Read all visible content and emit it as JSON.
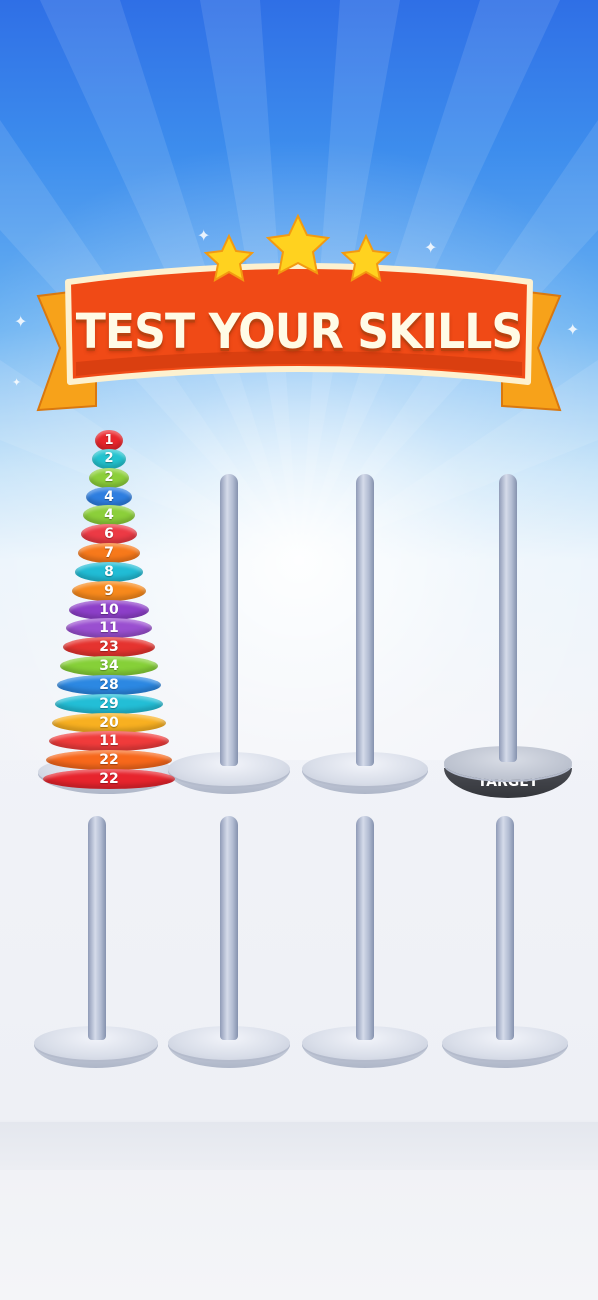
{
  "banner": {
    "title": "TEST YOUR SKILLS",
    "star_count": 3
  },
  "target_label": "TARGET",
  "colors": {
    "banner_fill": "#f04a16",
    "banner_fold": "#f7a21a",
    "star": "#ffd21f",
    "pole": "#b3bdd3",
    "base": "#d9dee9",
    "target_base_band": "#3d3f45"
  },
  "rings": [
    {
      "label": "1",
      "color": "#e8262c"
    },
    {
      "label": "2",
      "color": "#23c3cf"
    },
    {
      "label": "2",
      "color": "#8ccf3a"
    },
    {
      "label": "4",
      "color": "#2e7ee0"
    },
    {
      "label": "4",
      "color": "#8ccf3a"
    },
    {
      "label": "6",
      "color": "#ec3a45"
    },
    {
      "label": "7",
      "color": "#f7791b"
    },
    {
      "label": "8",
      "color": "#21bcd5"
    },
    {
      "label": "9",
      "color": "#f7891c"
    },
    {
      "label": "10",
      "color": "#8d3fc9"
    },
    {
      "label": "11",
      "color": "#9a4fd0"
    },
    {
      "label": "23",
      "color": "#e5332f"
    },
    {
      "label": "34",
      "color": "#86d038"
    },
    {
      "label": "28",
      "color": "#2c88e2"
    },
    {
      "label": "29",
      "color": "#23bed6"
    },
    {
      "label": "20",
      "color": "#f8b021"
    },
    {
      "label": "11",
      "color": "#f03b3b"
    },
    {
      "label": "22",
      "color": "#f7681b"
    },
    {
      "label": "22",
      "color": "#e7242d"
    }
  ]
}
